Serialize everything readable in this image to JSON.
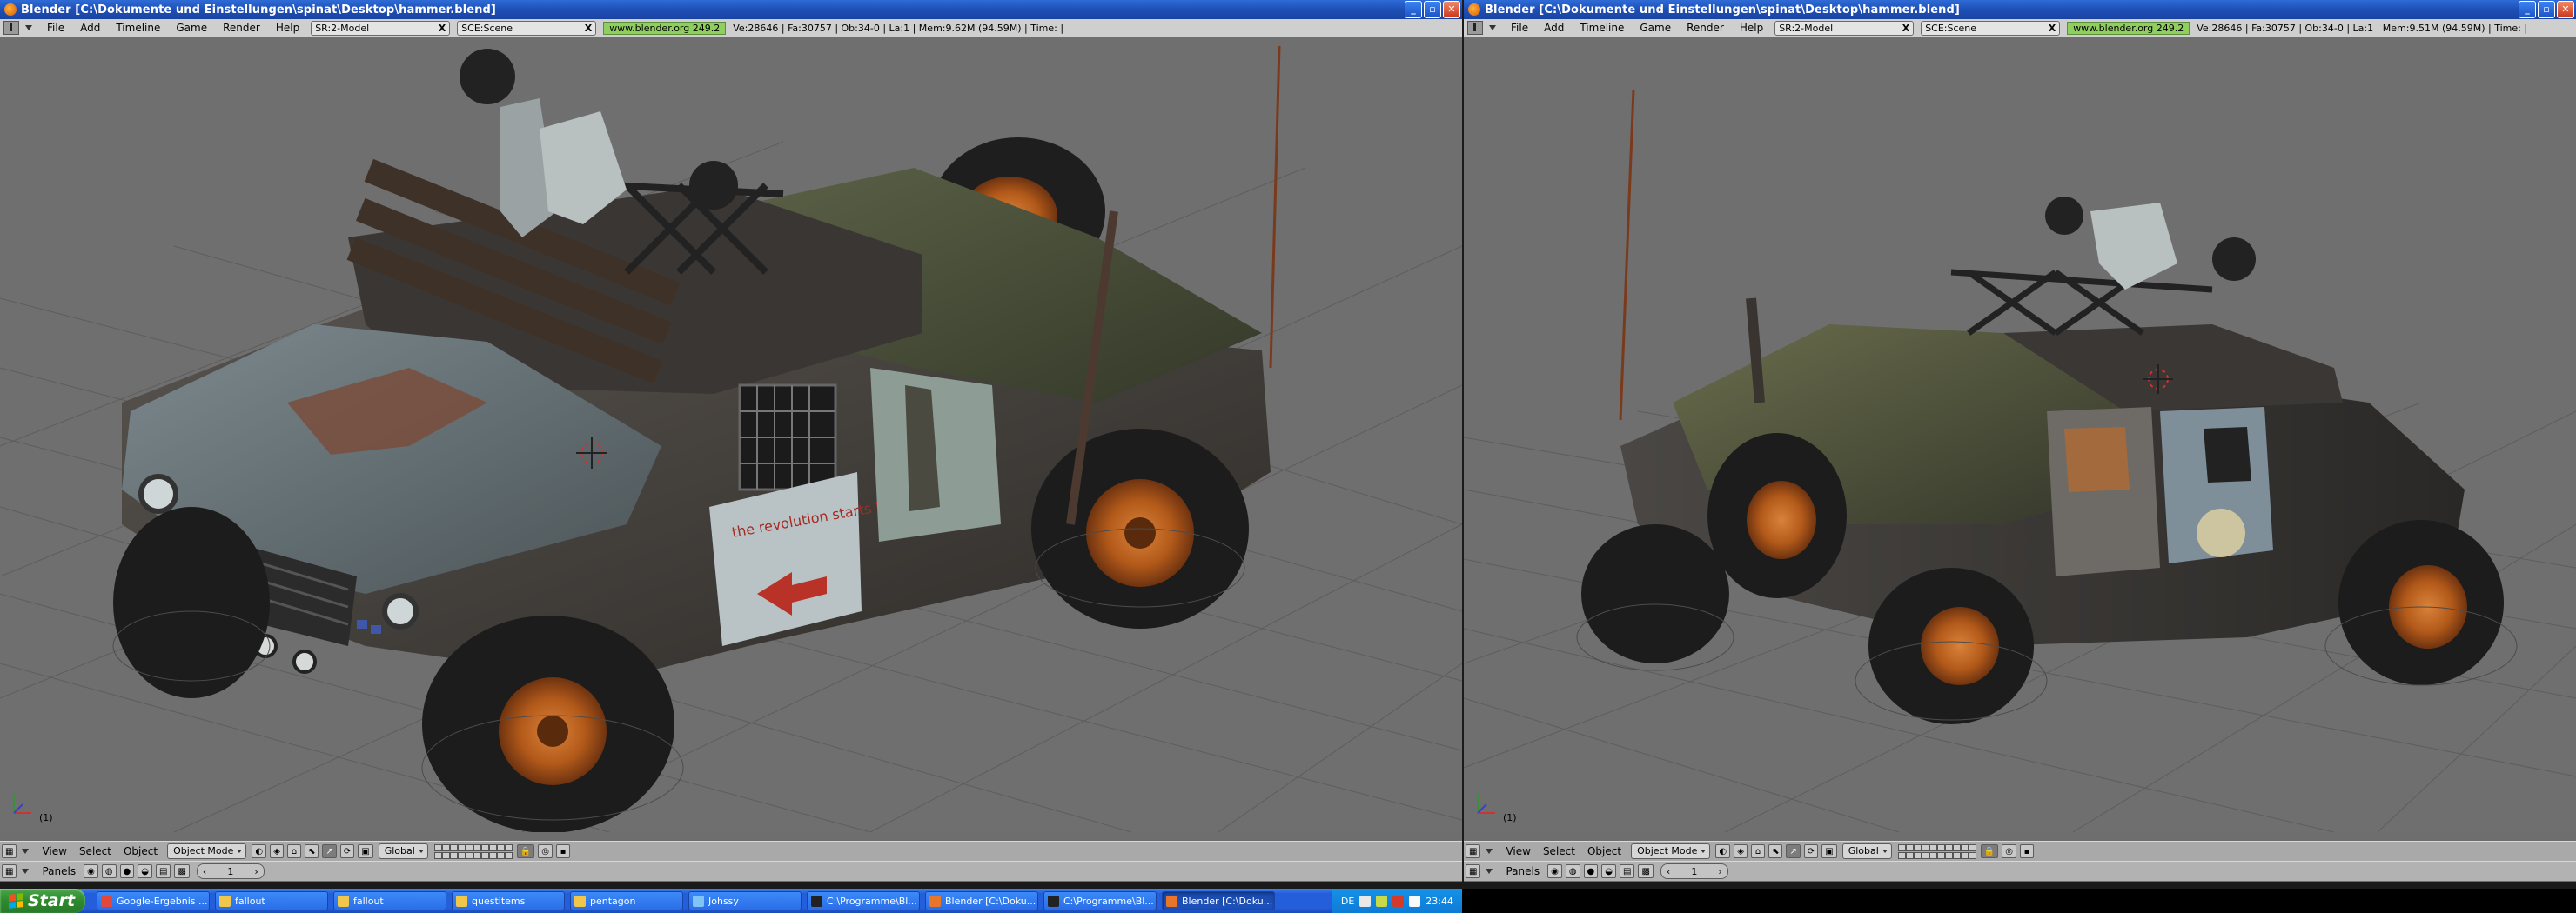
{
  "colors": {
    "titlebar": "#2458c7",
    "menubar": "#cfcfcf",
    "viewport_bg": "#6f6f6f",
    "grid": "#585858",
    "url_badge": "#8fcf5f",
    "wheel_rim": "#c2641f",
    "taskbar": "#245edb",
    "start_button": "#2e8a2e"
  },
  "left_window": {
    "title": "Blender [C:\\Dokumente und Einstellungen\\spinat\\Desktop\\hammer.blend]",
    "menus": [
      "File",
      "Add",
      "Timeline",
      "Game",
      "Render",
      "Help"
    ],
    "screen_field": "SR:2-Model",
    "scene_field": "SCE:Scene",
    "url": "www.blender.org 249.2",
    "stats": "Ve:28646 | Fa:30757 | Ob:34-0 | La:1  | Mem:9.62M (94.59M)  | Time: |",
    "frame_label": "(1)",
    "header1": {
      "menus": [
        "View",
        "Select",
        "Object"
      ],
      "mode": "Object Mode",
      "orientation": "Global"
    },
    "header2": {
      "panels_label": "Panels",
      "frame_value": "1"
    }
  },
  "right_window": {
    "title": "Blender [C:\\Dokumente und Einstellungen\\spinat\\Desktop\\hammer.blend]",
    "menus": [
      "File",
      "Add",
      "Timeline",
      "Game",
      "Render",
      "Help"
    ],
    "screen_field": "SR:2-Model",
    "scene_field": "SCE:Scene",
    "url": "www.blender.org 249.2",
    "stats": "Ve:28646 | Fa:30757 | Ob:34-0 | La:1  | Mem:9.51M (94.59M)  | Time: |",
    "frame_label": "(1)",
    "header1": {
      "menus": [
        "View",
        "Select",
        "Object"
      ],
      "mode": "Object Mode",
      "orientation": "Global"
    },
    "header2": {
      "panels_label": "Panels",
      "frame_value": "1"
    }
  },
  "vehicle_decals": {
    "door_text": "the revolution starts here"
  },
  "taskbar": {
    "start_label": "Start",
    "items": [
      {
        "label": "Google-Ergebnis ...",
        "icon_color": "#e2473b",
        "active": false
      },
      {
        "label": "fallout",
        "icon_color": "#f0c74a",
        "active": false
      },
      {
        "label": "fallout",
        "icon_color": "#f0c74a",
        "active": false
      },
      {
        "label": "questitems",
        "icon_color": "#f0c74a",
        "active": false
      },
      {
        "label": "pentagon",
        "icon_color": "#f0c74a",
        "active": false
      },
      {
        "label": "Johssy",
        "icon_color": "#7fc4f5",
        "active": false
      },
      {
        "label": "C:\\Programme\\Bl...",
        "icon_color": "#222222",
        "active": false
      },
      {
        "label": "Blender [C:\\Doku...",
        "icon_color": "#e8762a",
        "active": false
      },
      {
        "label": "C:\\Programme\\Bl...",
        "icon_color": "#222222",
        "active": false
      },
      {
        "label": "Blender [C:\\Doku...",
        "icon_color": "#e8762a",
        "active": true
      }
    ],
    "language": "DE",
    "clock": "23:44"
  }
}
